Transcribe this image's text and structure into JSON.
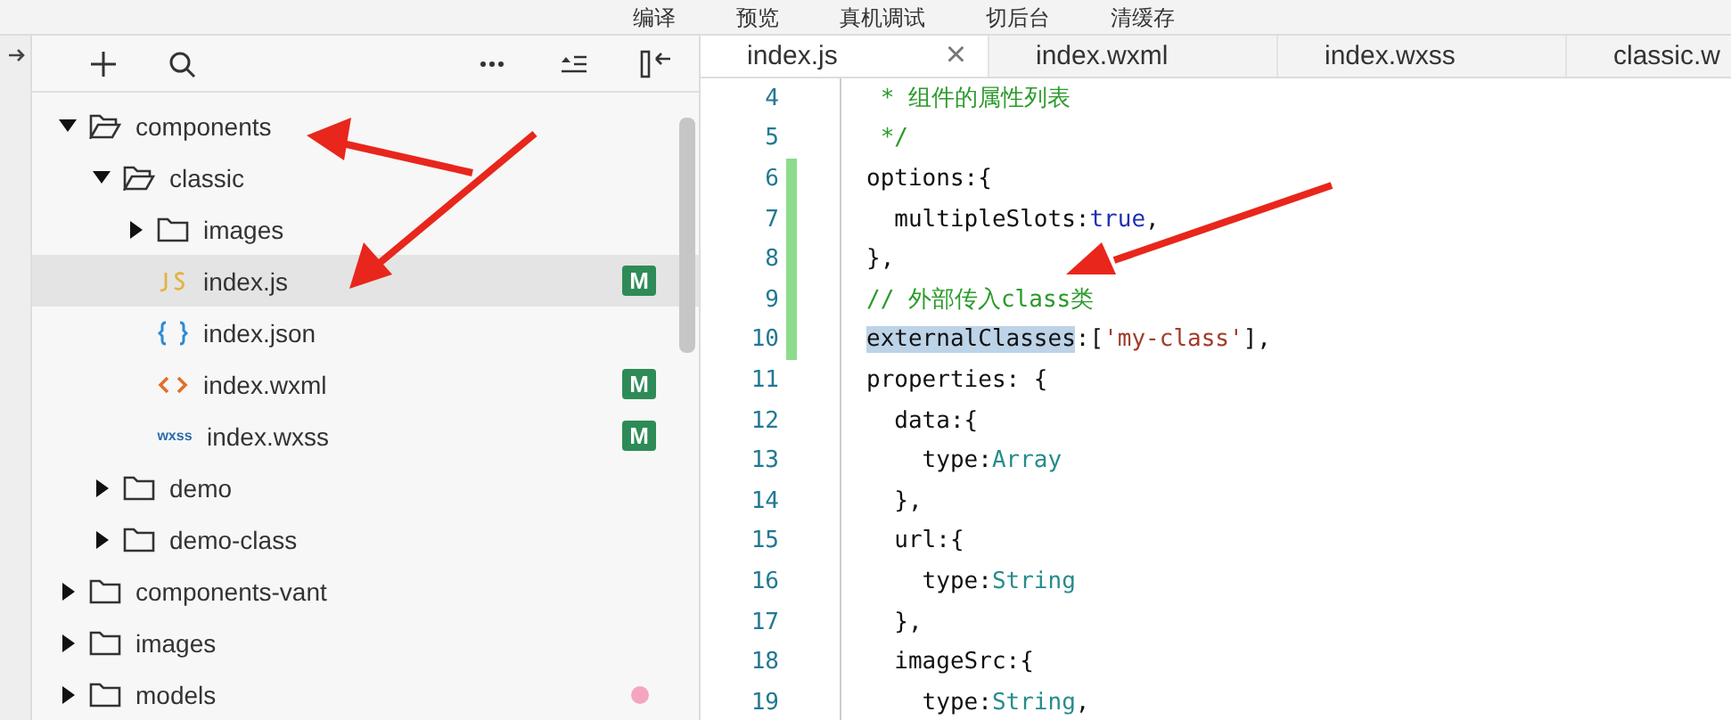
{
  "top_toolbar": [
    "编译",
    "预览",
    "真机调试",
    "切后台",
    "清缓存"
  ],
  "explorer": {
    "tree": [
      {
        "label": "components",
        "kind": "folder",
        "expanded": true,
        "selected": false,
        "children": [
          {
            "label": "classic",
            "kind": "folder",
            "expanded": true,
            "selected": false,
            "children": [
              {
                "label": "images",
                "kind": "folder",
                "expanded": false,
                "selected": false
              },
              {
                "label": "index.js",
                "kind": "js",
                "selected": true,
                "badge": "M"
              },
              {
                "label": "index.json",
                "kind": "json",
                "selected": false
              },
              {
                "label": "index.wxml",
                "kind": "wxml",
                "selected": false,
                "badge": "M"
              },
              {
                "label": "index.wxss",
                "kind": "wxss",
                "icon_text": "wxss",
                "selected": false,
                "badge": "M"
              }
            ]
          },
          {
            "label": "demo",
            "kind": "folder",
            "expanded": false,
            "selected": false
          },
          {
            "label": "demo-class",
            "kind": "folder",
            "expanded": false,
            "selected": false
          }
        ]
      },
      {
        "label": "components-vant",
        "kind": "folder",
        "expanded": false,
        "selected": false
      },
      {
        "label": "images",
        "kind": "folder",
        "expanded": false,
        "selected": false
      },
      {
        "label": "models",
        "kind": "folder",
        "expanded": false,
        "selected": false,
        "dot": true
      }
    ]
  },
  "tabs": [
    {
      "label": "index.js",
      "selected": true,
      "close": "×"
    },
    {
      "label": "index.wxml",
      "selected": false
    },
    {
      "label": "index.wxss",
      "selected": false
    },
    {
      "label": "classic.w",
      "selected": false
    }
  ],
  "code": [
    {
      "n": "4",
      "changed": false,
      "tokens": [
        {
          "kind": "comment",
          "text": " * 组件的属性列表"
        }
      ]
    },
    {
      "n": "5",
      "changed": false,
      "tokens": [
        {
          "kind": "comment",
          "text": " */"
        }
      ]
    },
    {
      "n": "6",
      "changed": true,
      "tokens": [
        {
          "kind": "plain",
          "text": "options:{"
        }
      ]
    },
    {
      "n": "7",
      "changed": true,
      "tokens": [
        {
          "kind": "plain",
          "text": "  multipleSlots:"
        },
        {
          "kind": "keyword",
          "text": "true"
        },
        {
          "kind": "plain",
          "text": ","
        }
      ]
    },
    {
      "n": "8",
      "changed": true,
      "tokens": [
        {
          "kind": "plain",
          "text": "},"
        }
      ]
    },
    {
      "n": "9",
      "changed": true,
      "tokens": [
        {
          "kind": "comment",
          "text": "// 外部传入class类"
        }
      ]
    },
    {
      "n": "10",
      "changed": true,
      "tokens": [
        {
          "kind": "selected",
          "text": "externalClasses"
        },
        {
          "kind": "plain",
          "text": ":["
        },
        {
          "kind": "string",
          "text": "'my-class'"
        },
        {
          "kind": "plain",
          "text": "],"
        }
      ]
    },
    {
      "n": "11",
      "changed": false,
      "tokens": [
        {
          "kind": "plain",
          "text": "properties: {"
        }
      ]
    },
    {
      "n": "12",
      "changed": false,
      "tokens": [
        {
          "kind": "plain",
          "text": "  data:{"
        }
      ]
    },
    {
      "n": "13",
      "changed": false,
      "tokens": [
        {
          "kind": "plain",
          "text": "    type:"
        },
        {
          "kind": "type",
          "text": "Array"
        }
      ]
    },
    {
      "n": "14",
      "changed": false,
      "tokens": [
        {
          "kind": "plain",
          "text": "  },"
        }
      ]
    },
    {
      "n": "15",
      "changed": false,
      "tokens": [
        {
          "kind": "plain",
          "text": "  url:{"
        }
      ]
    },
    {
      "n": "16",
      "changed": false,
      "tokens": [
        {
          "kind": "plain",
          "text": "    type:"
        },
        {
          "kind": "type",
          "text": "String"
        }
      ]
    },
    {
      "n": "17",
      "changed": false,
      "tokens": [
        {
          "kind": "plain",
          "text": "  },"
        }
      ]
    },
    {
      "n": "18",
      "changed": false,
      "tokens": [
        {
          "kind": "plain",
          "text": "  imageSrc:{"
        }
      ]
    },
    {
      "n": "19",
      "changed": false,
      "tokens": [
        {
          "kind": "plain",
          "text": "    type:"
        },
        {
          "kind": "type",
          "text": "String"
        },
        {
          "kind": "plain",
          "text": ","
        }
      ]
    }
  ]
}
